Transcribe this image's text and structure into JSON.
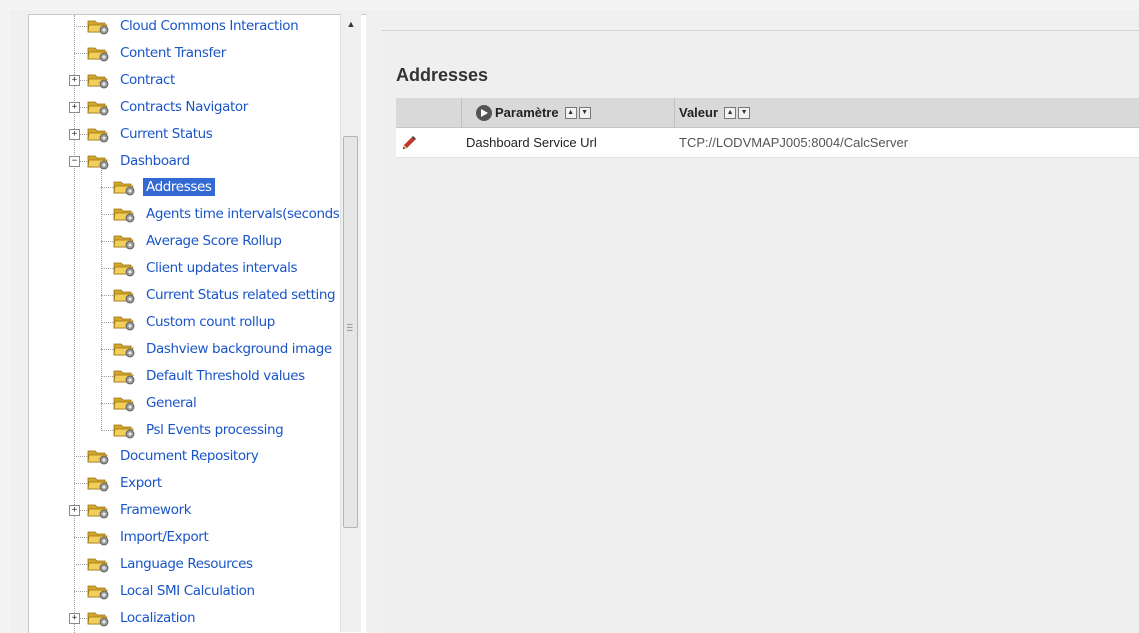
{
  "tree": {
    "items": [
      {
        "label": "Cloud Commons Interaction",
        "level": 1,
        "expander": ""
      },
      {
        "label": "Content Transfer",
        "level": 1,
        "expander": ""
      },
      {
        "label": "Contract",
        "level": 1,
        "expander": "+"
      },
      {
        "label": "Contracts Navigator",
        "level": 1,
        "expander": "+"
      },
      {
        "label": "Current Status",
        "level": 1,
        "expander": "+"
      },
      {
        "label": "Dashboard",
        "level": 1,
        "expander": "−"
      },
      {
        "label": "Addresses",
        "level": 2,
        "expander": "",
        "selected": true
      },
      {
        "label": "Agents time intervals(seconds",
        "level": 2,
        "expander": ""
      },
      {
        "label": "Average Score Rollup",
        "level": 2,
        "expander": ""
      },
      {
        "label": "Client updates intervals",
        "level": 2,
        "expander": ""
      },
      {
        "label": "Current Status related setting",
        "level": 2,
        "expander": ""
      },
      {
        "label": "Custom count rollup",
        "level": 2,
        "expander": ""
      },
      {
        "label": "Dashview background image",
        "level": 2,
        "expander": ""
      },
      {
        "label": "Default Threshold values",
        "level": 2,
        "expander": ""
      },
      {
        "label": "General",
        "level": 2,
        "expander": ""
      },
      {
        "label": "Psl Events processing",
        "level": 2,
        "expander": ""
      },
      {
        "label": "Document Repository",
        "level": 1,
        "expander": ""
      },
      {
        "label": "Export",
        "level": 1,
        "expander": ""
      },
      {
        "label": "Framework",
        "level": 1,
        "expander": "+"
      },
      {
        "label": "Import/Export",
        "level": 1,
        "expander": ""
      },
      {
        "label": "Language Resources",
        "level": 1,
        "expander": ""
      },
      {
        "label": "Local SMI Calculation",
        "level": 1,
        "expander": ""
      },
      {
        "label": "Localization",
        "level": 1,
        "expander": "+"
      }
    ]
  },
  "main": {
    "title": "Addresses",
    "columns": {
      "param": "Paramètre",
      "value": "Valeur"
    },
    "rows": [
      {
        "param": "Dashboard Service Url",
        "value": "TCP://LODVMAPJ005:8004/CalcServer"
      }
    ]
  },
  "colors": {
    "link": "#1a55c8",
    "selected_bg": "#3369d4",
    "header_bg": "#d9d9d9"
  }
}
